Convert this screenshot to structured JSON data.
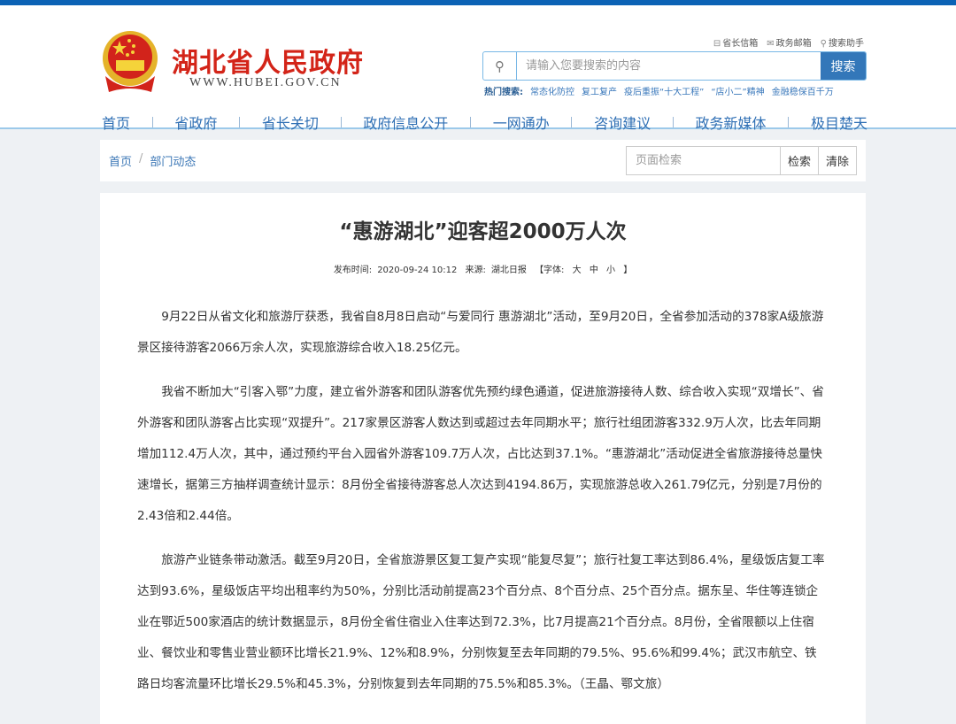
{
  "header": {
    "site_name": "湖北省人民政府",
    "site_url": "WWW.HUBEI.GOV.CN",
    "quick_links": [
      "省长信箱",
      "政务邮箱",
      "搜索助手"
    ],
    "search_placeholder": "请输入您要搜索的内容",
    "search_button": "搜索",
    "hot_label": "热门搜索:",
    "hot_items": [
      "常态化防控",
      "复工复产",
      "疫后重振“十大工程”",
      "“店小二”精神",
      "金融稳保百千万"
    ]
  },
  "nav": [
    "首页",
    "省政府",
    "省长关切",
    "政府信息公开",
    "一网通办",
    "咨询建议",
    "政务新媒体",
    "极目楚天"
  ],
  "breadcrumb": {
    "home": "首页",
    "sep": "/",
    "current": "部门动态"
  },
  "page_search": {
    "placeholder": "页面检索",
    "search": "检索",
    "clear": "清除"
  },
  "article": {
    "title": "“惠游湖北”迎客超2000万人次",
    "publish_label": "发布时间:",
    "publish_time": "2020-09-24 10:12",
    "source_label": "来源:",
    "source": "湖北日报",
    "font_label": "【字体:",
    "font_large": "大",
    "font_medium": "中",
    "font_small": "小",
    "font_end": "】",
    "paragraphs": [
      "9月22日从省文化和旅游厅获悉，我省自8月8日启动“与爱同行 惠游湖北”活动，至9月20日，全省参加活动的378家A级旅游景区接待游客2066万余人次，实现旅游综合收入18.25亿元。",
      "我省不断加大“引客入鄂”力度，建立省外游客和团队游客优先预约绿色通道，促进旅游接待人数、综合收入实现“双增长”、省外游客和团队游客占比实现“双提升”。217家景区游客人数达到或超过去年同期水平；旅行社组团游客332.9万人次，比去年同期增加112.4万人次，其中，通过预约平台入园省外游客109.7万人次，占比达到37.1%。“惠游湖北”活动促进全省旅游接待总量快速增长，据第三方抽样调查统计显示：8月份全省接待游客总人次达到4194.86万，实现旅游总收入261.79亿元，分别是7月份的2.43倍和2.44倍。",
      "旅游产业链条带动激活。截至9月20日，全省旅游景区复工复产实现“能复尽复”；旅行社复工率达到86.4%，星级饭店复工率达到93.6%，星级饭店平均出租率约为50%，分别比活动前提高23个百分点、8个百分点、25个百分点。据东呈、华住等连锁企业在鄂近500家酒店的统计数据显示，8月份全省住宿业入住率达到72.3%，比7月提高21个百分点。8月份，全省限额以上住宿业、餐饮业和零售业营业额环比增长21.9%、12%和8.9%，分别恢复至去年同期的79.5%、95.6%和99.4%；武汉市航空、铁路日均客流量环比增长29.5%和45.3%，分别恢复到去年同期的75.5%和85.3%。（王晶、鄂文旅）"
    ]
  }
}
